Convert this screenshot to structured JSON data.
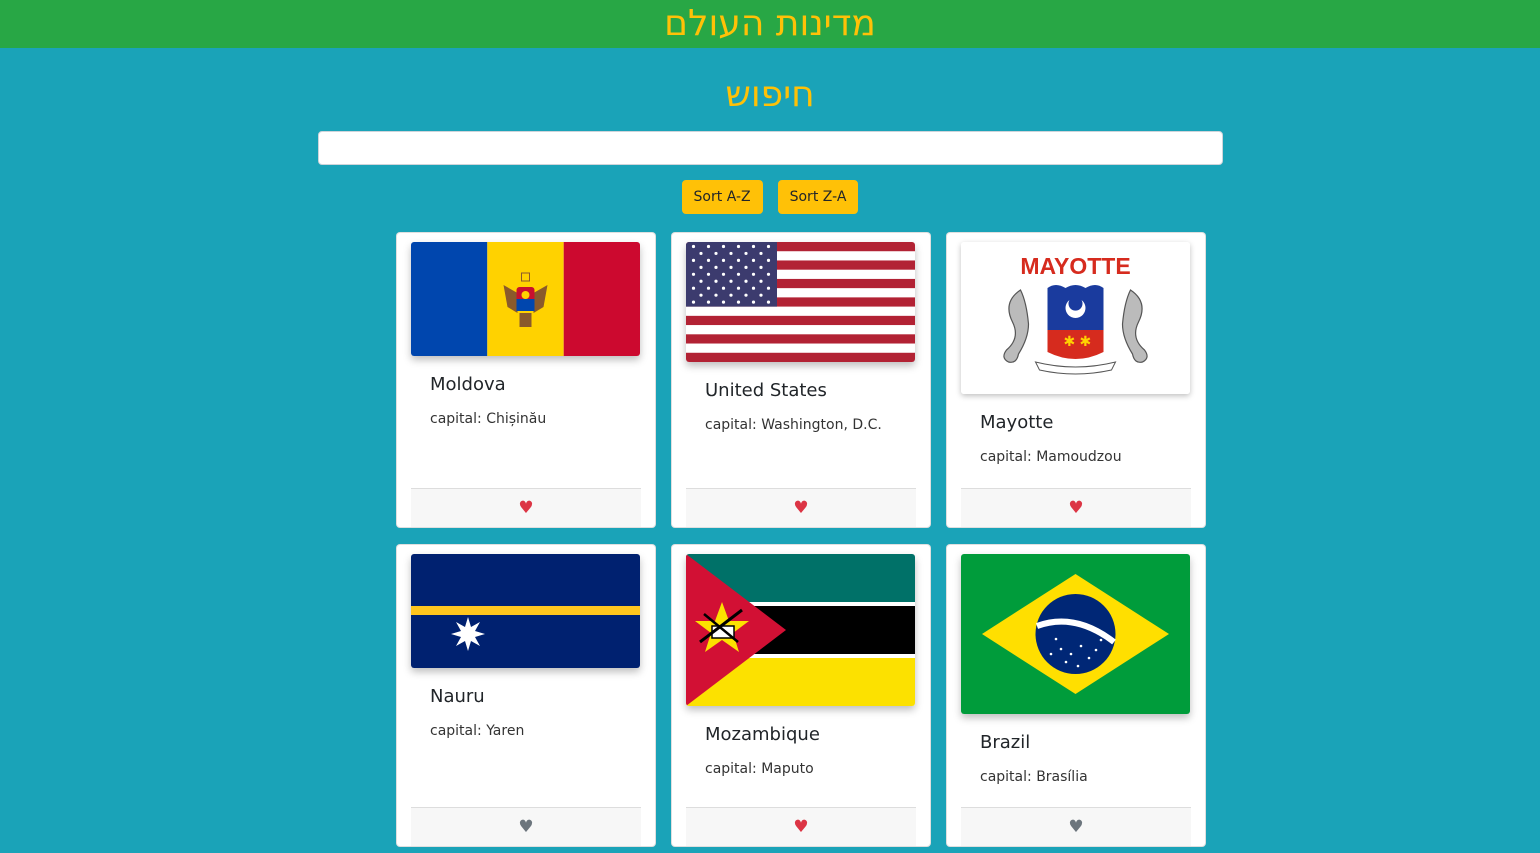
{
  "header": {
    "title": "מדינות העולם"
  },
  "search": {
    "title": "חיפוש",
    "value": "",
    "placeholder": ""
  },
  "sort": {
    "az_label": "Sort A-Z",
    "za_label": "Sort Z-A"
  },
  "capital_prefix": "capital: ",
  "colors": {
    "header_bg": "#28a745",
    "page_bg": "#1aa3b8",
    "accent": "#ffc107",
    "heart_fav": "#dc3545",
    "heart_off": "#6c757d"
  },
  "countries": [
    {
      "name": "Moldova",
      "capital": "Chișinău",
      "favorite": true,
      "flag_icon": "flag-moldova"
    },
    {
      "name": "United States",
      "capital": "Washington, D.C.",
      "favorite": true,
      "flag_icon": "flag-united-states"
    },
    {
      "name": "Mayotte",
      "capital": "Mamoudzou",
      "favorite": true,
      "flag_icon": "flag-mayotte",
      "flag_text": "MAYOTTE"
    },
    {
      "name": "Nauru",
      "capital": "Yaren",
      "favorite": false,
      "flag_icon": "flag-nauru"
    },
    {
      "name": "Mozambique",
      "capital": "Maputo",
      "favorite": true,
      "flag_icon": "flag-mozambique"
    },
    {
      "name": "Brazil",
      "capital": "Brasília",
      "favorite": false,
      "flag_icon": "flag-brazil"
    }
  ]
}
